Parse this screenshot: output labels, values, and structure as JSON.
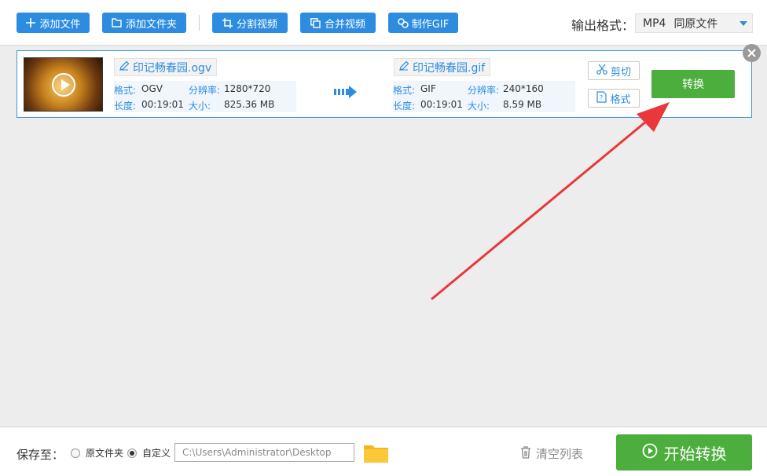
{
  "toolbar": {
    "add_file": "添加文件",
    "add_folder": "添加文件夹",
    "split_video": "分割视频",
    "merge_video": "合并视频",
    "make_gif": "制作GIF",
    "output_format_label": "输出格式：",
    "output_format_value": "MP4",
    "output_format_dest": "同原文件"
  },
  "item": {
    "source": {
      "filename": "印记畅春园.ogv",
      "format_label": "格式:",
      "format": "OGV",
      "resolution_label": "分辨率:",
      "resolution": "1280*720",
      "duration_label": "长度:",
      "duration": "00:19:01",
      "size_label": "大小:",
      "size": "825.36 MB"
    },
    "target": {
      "filename": "印记畅春园.gif",
      "format_label": "格式:",
      "format": "GIF",
      "resolution_label": "分辨率:",
      "resolution": "240*160",
      "duration_label": "长度:",
      "duration": "00:19:01",
      "size_label": "大小:",
      "size": "8.59 MB"
    },
    "cut_label": "剪切",
    "format_label": "格式",
    "convert_label": "转换"
  },
  "bottom": {
    "save_to_label": "保存至：",
    "option_original": "原文件夹",
    "option_custom": "自定义",
    "path": "C:\\Users\\Administrator\\Desktop",
    "clear_list": "清空列表",
    "start_convert": "开始转换"
  },
  "colors": {
    "accent": "#2d8ce0",
    "green": "#4cae3c",
    "annotation_arrow": "#e8383a"
  }
}
